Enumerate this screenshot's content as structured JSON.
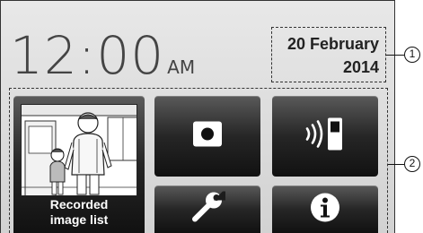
{
  "clock": {
    "time": "12:00",
    "period": "AM"
  },
  "date": {
    "line1": "20 February",
    "line2": "2014"
  },
  "tiles": {
    "recorded_images": {
      "label_line1": "Recorded",
      "label_line2": "image list",
      "icon": "scene-thumbnail-icon"
    },
    "record": {
      "icon": "record-icon"
    },
    "intercom": {
      "icon": "intercom-handset-icon"
    },
    "settings": {
      "icon": "wrench-icon"
    },
    "info": {
      "icon": "info-icon"
    }
  },
  "callouts": {
    "date_area": "1",
    "menu_area": "2"
  },
  "colors": {
    "tile_top": "#5a5a5a",
    "tile_bottom": "#111111",
    "screen_bg": "#dedede"
  }
}
